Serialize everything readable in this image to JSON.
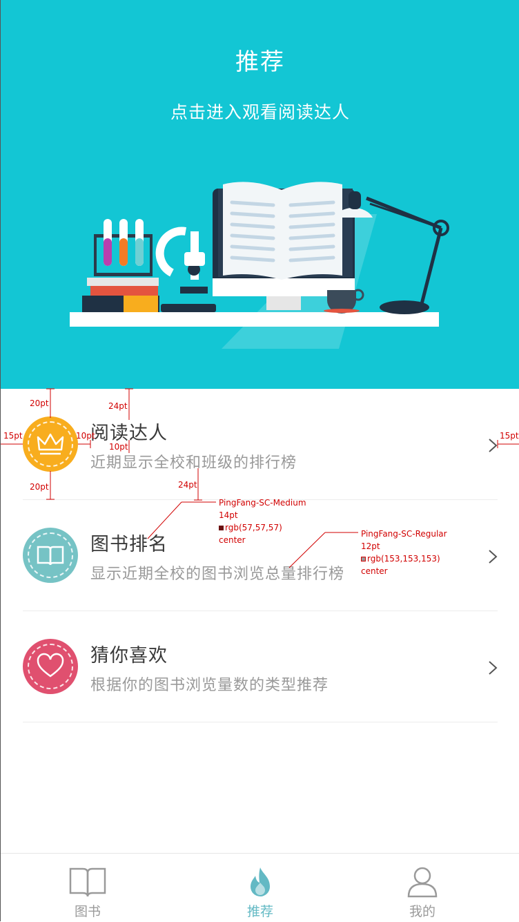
{
  "hero": {
    "title": "推荐",
    "subtitle": "点击进入观看阅读达人",
    "bg_color": "#13c6d4"
  },
  "items": [
    {
      "title": "阅读达人",
      "description": "近期显示全校和班级的排行榜",
      "icon": "crown-icon",
      "color": "#f8ad1e"
    },
    {
      "title": "图书排名",
      "description": "显示近期全校的图书浏览总量排行榜",
      "icon": "book-icon",
      "color": "#76c3c5"
    },
    {
      "title": "猜你喜欢",
      "description": "根据你的图书浏览量数的类型推荐",
      "icon": "heart-icon",
      "color": "#e0506f"
    }
  ],
  "annotations": {
    "top_gap": "20pt",
    "title_gap": "24pt",
    "left_margin": "15pt",
    "icon_text_gap": "10pt",
    "line_gap": "10pt",
    "bottom_gap": "20pt",
    "desc_gap": "24pt",
    "right_margin": "15pt",
    "title_spec": {
      "font": "PingFang-SC-Medium",
      "size": "14pt",
      "color": "rgb(57,57,57)",
      "align": "center"
    },
    "desc_spec": {
      "font": "PingFang-SC-Regular",
      "size": "12pt",
      "color": "rgb(153,153,153)",
      "align": "center"
    }
  },
  "tabbar": {
    "tabs": [
      {
        "label": "图书",
        "icon": "open-book-icon",
        "active": false
      },
      {
        "label": "推荐",
        "icon": "flame-icon",
        "active": true
      },
      {
        "label": "我的",
        "icon": "user-icon",
        "active": false
      }
    ],
    "active_color": "#63b9c4",
    "inactive_color": "#9a9a9a"
  }
}
